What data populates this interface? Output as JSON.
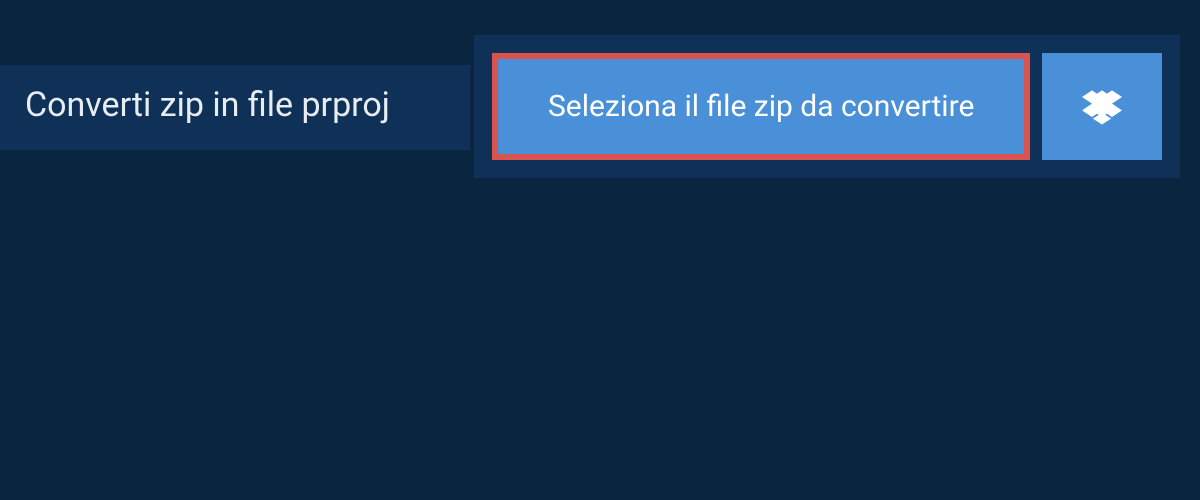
{
  "header": {
    "title": "Converti zip in file prproj"
  },
  "upload": {
    "select_button_label": "Seleziona il file zip da convertire",
    "dropbox_icon": "dropbox-icon"
  },
  "colors": {
    "background": "#0a2540",
    "panel": "#0f3157",
    "button_primary": "#4a90d9",
    "highlight_border": "#d9534f",
    "text_light": "#e8edf2",
    "text_white": "#ffffff"
  }
}
